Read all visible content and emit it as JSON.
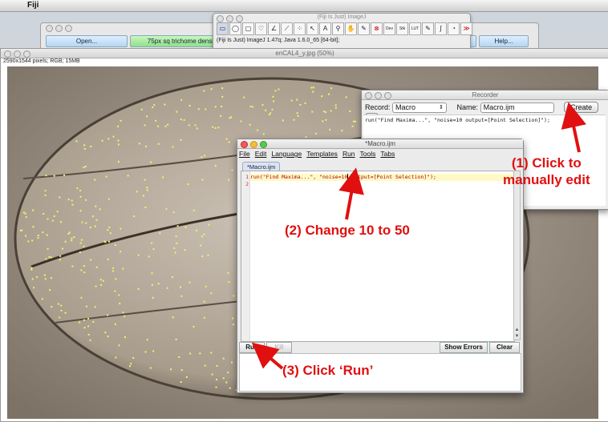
{
  "menubar": {
    "app_name": "Fiji"
  },
  "launcher": {
    "buttons": [
      "Open...",
      "75px sq trichome density",
      "",
      "",
      "",
      "",
      "Help..."
    ]
  },
  "ij_toolbar": {
    "title": "(Fiji Is Just) ImageJ",
    "tools": [
      "▭",
      "◯",
      "▢",
      "♡",
      "∠",
      "⟋",
      "⁘",
      "↖",
      "A",
      "⚲",
      "✋",
      "✎",
      "⊗",
      "Dev",
      "Stk",
      "LUT",
      "✎",
      "∫",
      "◔",
      "≫"
    ],
    "status": "(Fiji Is Just) ImageJ 1.47q; Java 1.6.0_65 [64-bit];"
  },
  "image_window": {
    "title": "enCAL4_y.jpg (50%)",
    "info": "2590x1544 pixels; RGB; 15MB"
  },
  "recorder": {
    "title": "Recorder",
    "record_label": "Record:",
    "record_value": "Macro",
    "name_label": "Name:",
    "name_value": "Macro.ijm",
    "create_label": "Create",
    "help_label": "?",
    "content": "run(\"Find Maxima...\", \"noise=10 output=[Point Selection]\");"
  },
  "editor": {
    "title": "*Macro.ijm",
    "menus": [
      "File",
      "Edit",
      "Language",
      "Templates",
      "Run",
      "Tools",
      "Tabs"
    ],
    "tab": "*Macro.ijm",
    "line_numbers": [
      "1",
      "2"
    ],
    "code_line_1a": "run(\"Find Maxima...\", \"noise=10",
    "code_line_1b": " output=[Point Selection]\");",
    "buttons": {
      "run": "Run",
      "kill": "Kill",
      "show_errors": "Show Errors",
      "clear": "Clear"
    }
  },
  "annotations": {
    "step1_line1": "(1) Click to",
    "step1_line2": "manually edit",
    "step2": "(2) Change 10 to 50",
    "step3": "(3) Click ‘Run’"
  },
  "colors": {
    "annotation": "#e01010",
    "code_string": "#b00000",
    "highlight_line": "#fff9c4"
  }
}
